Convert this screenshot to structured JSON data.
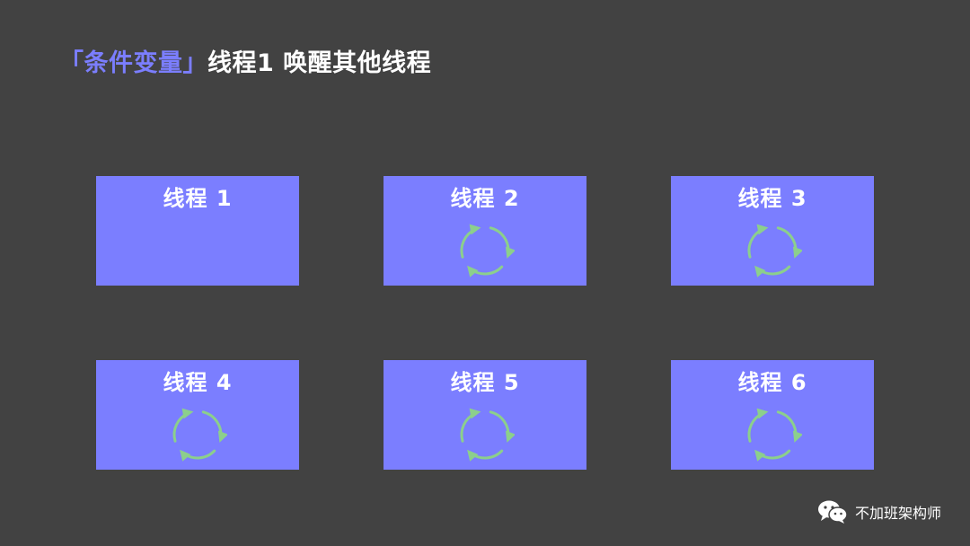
{
  "title": {
    "highlight": "「条件变量」",
    "rest": "线程1 唤醒其他线程"
  },
  "threads": [
    {
      "label": "线程 1",
      "waiting": false
    },
    {
      "label": "线程 2",
      "waiting": true
    },
    {
      "label": "线程 3",
      "waiting": true
    },
    {
      "label": "线程 4",
      "waiting": true
    },
    {
      "label": "线程 5",
      "waiting": true
    },
    {
      "label": "线程 6",
      "waiting": true
    }
  ],
  "footer": {
    "icon": "wechat-icon",
    "text": "不加班架构师"
  },
  "colors": {
    "background": "#424242",
    "box": "#7b7eff",
    "highlight": "#7b7eff",
    "cycle": "#8ccf8c"
  }
}
